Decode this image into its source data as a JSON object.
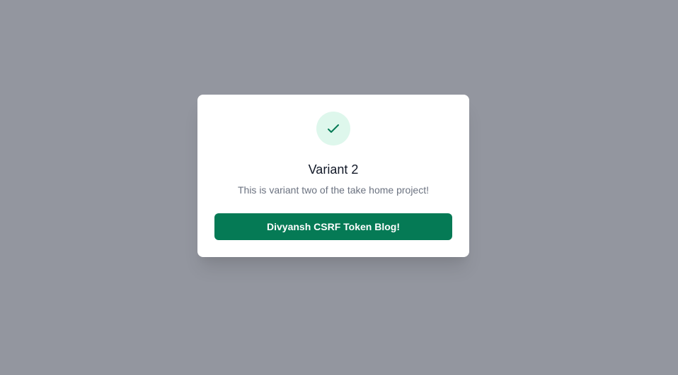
{
  "modal": {
    "icon": "check-icon",
    "title": "Variant 2",
    "description": "This is variant two of the take home project!",
    "button_label": "Divyansh CSRF Token Blog!"
  },
  "colors": {
    "overlay": "#93969f",
    "icon_bg": "#def7ec",
    "icon_stroke": "#057a55",
    "button_bg": "#057a55",
    "title_text": "#111827",
    "desc_text": "#6b7280"
  }
}
